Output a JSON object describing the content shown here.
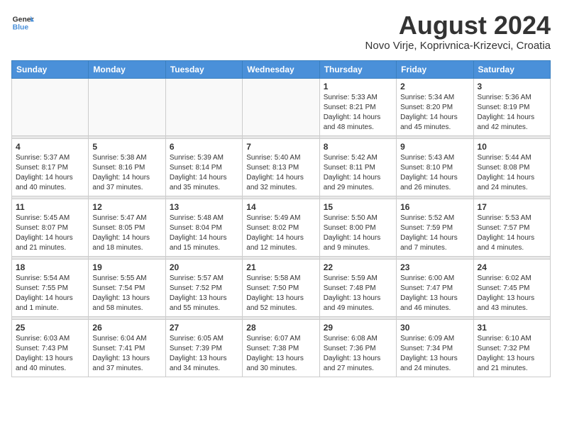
{
  "header": {
    "logo_general": "General",
    "logo_blue": "Blue",
    "month": "August 2024",
    "location": "Novo Virje, Koprivnica-Krizevci, Croatia"
  },
  "days_of_week": [
    "Sunday",
    "Monday",
    "Tuesday",
    "Wednesday",
    "Thursday",
    "Friday",
    "Saturday"
  ],
  "weeks": [
    [
      {
        "day": "",
        "info": ""
      },
      {
        "day": "",
        "info": ""
      },
      {
        "day": "",
        "info": ""
      },
      {
        "day": "",
        "info": ""
      },
      {
        "day": "1",
        "info": "Sunrise: 5:33 AM\nSunset: 8:21 PM\nDaylight: 14 hours\nand 48 minutes."
      },
      {
        "day": "2",
        "info": "Sunrise: 5:34 AM\nSunset: 8:20 PM\nDaylight: 14 hours\nand 45 minutes."
      },
      {
        "day": "3",
        "info": "Sunrise: 5:36 AM\nSunset: 8:19 PM\nDaylight: 14 hours\nand 42 minutes."
      }
    ],
    [
      {
        "day": "4",
        "info": "Sunrise: 5:37 AM\nSunset: 8:17 PM\nDaylight: 14 hours\nand 40 minutes."
      },
      {
        "day": "5",
        "info": "Sunrise: 5:38 AM\nSunset: 8:16 PM\nDaylight: 14 hours\nand 37 minutes."
      },
      {
        "day": "6",
        "info": "Sunrise: 5:39 AM\nSunset: 8:14 PM\nDaylight: 14 hours\nand 35 minutes."
      },
      {
        "day": "7",
        "info": "Sunrise: 5:40 AM\nSunset: 8:13 PM\nDaylight: 14 hours\nand 32 minutes."
      },
      {
        "day": "8",
        "info": "Sunrise: 5:42 AM\nSunset: 8:11 PM\nDaylight: 14 hours\nand 29 minutes."
      },
      {
        "day": "9",
        "info": "Sunrise: 5:43 AM\nSunset: 8:10 PM\nDaylight: 14 hours\nand 26 minutes."
      },
      {
        "day": "10",
        "info": "Sunrise: 5:44 AM\nSunset: 8:08 PM\nDaylight: 14 hours\nand 24 minutes."
      }
    ],
    [
      {
        "day": "11",
        "info": "Sunrise: 5:45 AM\nSunset: 8:07 PM\nDaylight: 14 hours\nand 21 minutes."
      },
      {
        "day": "12",
        "info": "Sunrise: 5:47 AM\nSunset: 8:05 PM\nDaylight: 14 hours\nand 18 minutes."
      },
      {
        "day": "13",
        "info": "Sunrise: 5:48 AM\nSunset: 8:04 PM\nDaylight: 14 hours\nand 15 minutes."
      },
      {
        "day": "14",
        "info": "Sunrise: 5:49 AM\nSunset: 8:02 PM\nDaylight: 14 hours\nand 12 minutes."
      },
      {
        "day": "15",
        "info": "Sunrise: 5:50 AM\nSunset: 8:00 PM\nDaylight: 14 hours\nand 9 minutes."
      },
      {
        "day": "16",
        "info": "Sunrise: 5:52 AM\nSunset: 7:59 PM\nDaylight: 14 hours\nand 7 minutes."
      },
      {
        "day": "17",
        "info": "Sunrise: 5:53 AM\nSunset: 7:57 PM\nDaylight: 14 hours\nand 4 minutes."
      }
    ],
    [
      {
        "day": "18",
        "info": "Sunrise: 5:54 AM\nSunset: 7:55 PM\nDaylight: 14 hours\nand 1 minute."
      },
      {
        "day": "19",
        "info": "Sunrise: 5:55 AM\nSunset: 7:54 PM\nDaylight: 13 hours\nand 58 minutes."
      },
      {
        "day": "20",
        "info": "Sunrise: 5:57 AM\nSunset: 7:52 PM\nDaylight: 13 hours\nand 55 minutes."
      },
      {
        "day": "21",
        "info": "Sunrise: 5:58 AM\nSunset: 7:50 PM\nDaylight: 13 hours\nand 52 minutes."
      },
      {
        "day": "22",
        "info": "Sunrise: 5:59 AM\nSunset: 7:48 PM\nDaylight: 13 hours\nand 49 minutes."
      },
      {
        "day": "23",
        "info": "Sunrise: 6:00 AM\nSunset: 7:47 PM\nDaylight: 13 hours\nand 46 minutes."
      },
      {
        "day": "24",
        "info": "Sunrise: 6:02 AM\nSunset: 7:45 PM\nDaylight: 13 hours\nand 43 minutes."
      }
    ],
    [
      {
        "day": "25",
        "info": "Sunrise: 6:03 AM\nSunset: 7:43 PM\nDaylight: 13 hours\nand 40 minutes."
      },
      {
        "day": "26",
        "info": "Sunrise: 6:04 AM\nSunset: 7:41 PM\nDaylight: 13 hours\nand 37 minutes."
      },
      {
        "day": "27",
        "info": "Sunrise: 6:05 AM\nSunset: 7:39 PM\nDaylight: 13 hours\nand 34 minutes."
      },
      {
        "day": "28",
        "info": "Sunrise: 6:07 AM\nSunset: 7:38 PM\nDaylight: 13 hours\nand 30 minutes."
      },
      {
        "day": "29",
        "info": "Sunrise: 6:08 AM\nSunset: 7:36 PM\nDaylight: 13 hours\nand 27 minutes."
      },
      {
        "day": "30",
        "info": "Sunrise: 6:09 AM\nSunset: 7:34 PM\nDaylight: 13 hours\nand 24 minutes."
      },
      {
        "day": "31",
        "info": "Sunrise: 6:10 AM\nSunset: 7:32 PM\nDaylight: 13 hours\nand 21 minutes."
      }
    ]
  ]
}
